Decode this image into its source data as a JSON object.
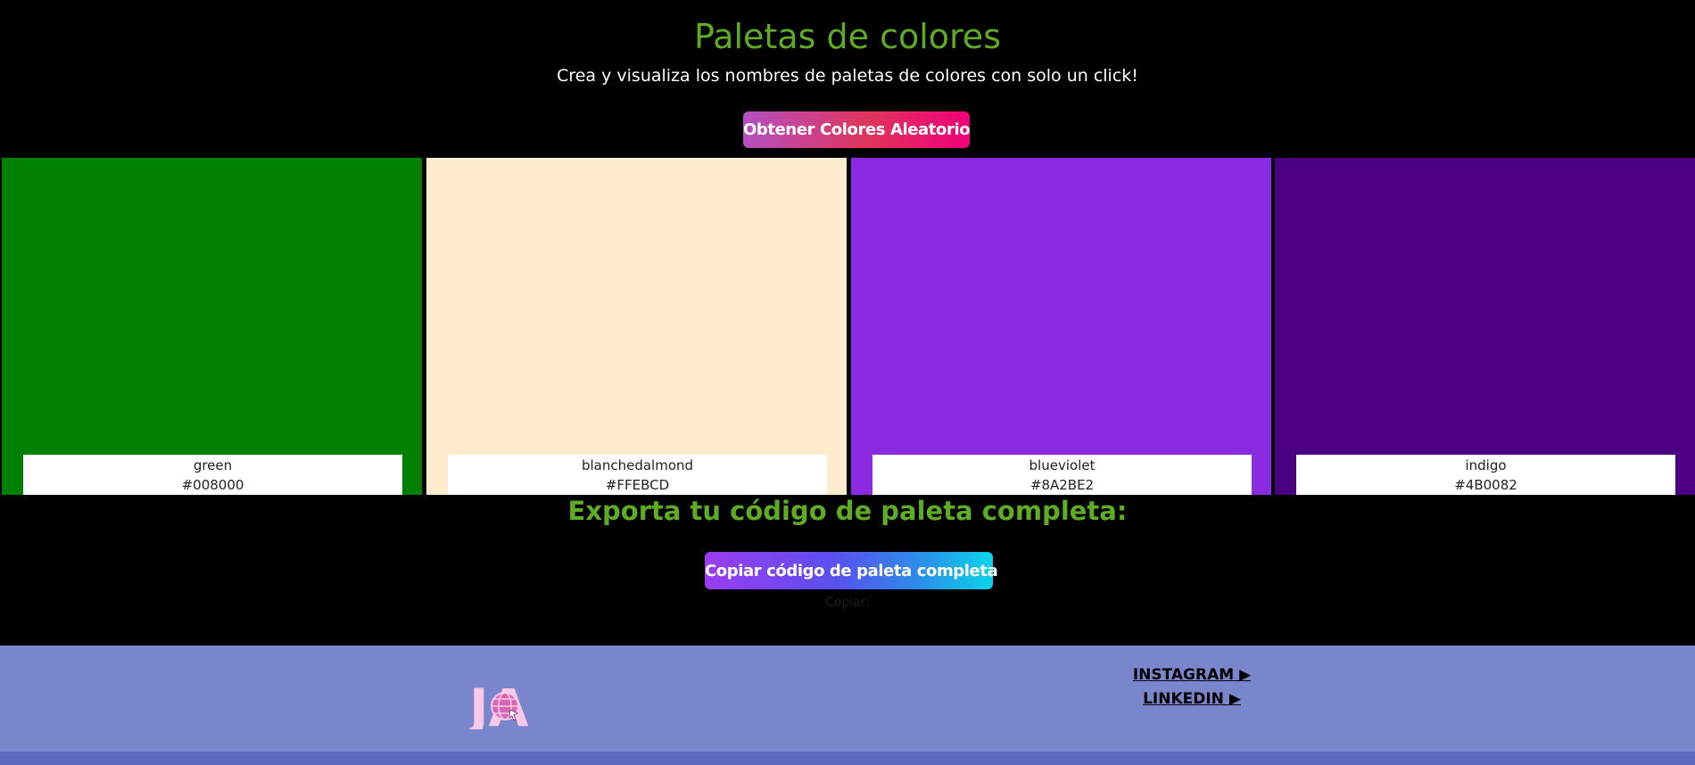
{
  "header": {
    "title": "Paletas de colores",
    "subtitle": "Crea y visualiza los nombres de paletas de colores con solo un click!",
    "random_button_label": "Obtener Colores Aleatorio"
  },
  "palette": [
    {
      "name": "green",
      "hex": "#008000"
    },
    {
      "name": "blanchedalmond",
      "hex": "#FFEBCD"
    },
    {
      "name": "blueviolet",
      "hex": "#8A2BE2"
    },
    {
      "name": "indigo",
      "hex": "#4B0082"
    }
  ],
  "export": {
    "title": "Exporta tu código de paleta completa:",
    "copy_button_label": "Copiar código de paleta completa",
    "copy_output": "Copiar:"
  },
  "footer": {
    "logo_text": "JA",
    "links": [
      {
        "label": "INSTAGRAM ▶"
      },
      {
        "label": "LINKEDIN ▶"
      }
    ]
  },
  "colors": {
    "accent_green": "#5eac24",
    "footer_bg": "#7986cb",
    "footer_bottom": "#5c6bc0",
    "logo_pink": "#f8c8e8"
  }
}
